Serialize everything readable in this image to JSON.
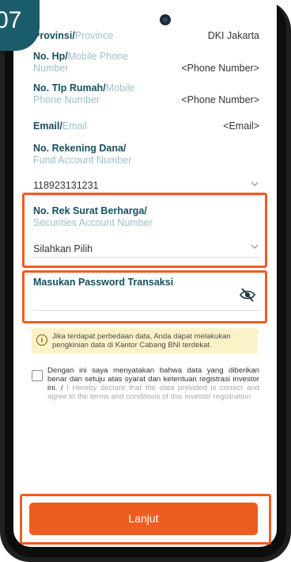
{
  "step_number": "07",
  "rows": [
    {
      "bold": "Provinsi/",
      "light": "Province",
      "value": "DKI Jakarta"
    },
    {
      "bold": "No. Hp/",
      "light": "Mobile Phone Number",
      "value": "<Phone Number>"
    },
    {
      "bold": "No. Tlp Rumah/",
      "light": "Mobile Phone Number",
      "value": "<Phone Number>"
    },
    {
      "bold": "Email/",
      "light": "Email",
      "value": "<Email>"
    }
  ],
  "fund_account": {
    "label_bold": "No. Rekening Dana/",
    "label_light": "Fund Account Number",
    "value": "118923131231"
  },
  "securities_account": {
    "label_bold": "No. Rek Surat Berharga/",
    "label_light": "Securities Account Number",
    "value": "Silahkan Pilih"
  },
  "password": {
    "label": "Masukan Password Transaksi",
    "value": ""
  },
  "info_note": "Jika terdapat perbedaan data, Anda dapat melakukan pengkinian data di Kantor Cabang BNI terdekat.",
  "consent": {
    "text_id": "Dengan ini saya menyatakan bahwa data yang diberikan benar dan setuju atas syarat dan ketentuan registrasi investor ini. /",
    "text_en": "I Hereby declare that the data provided is correct and agree to the terms and conditions of this investor registration"
  },
  "button_label": "Lanjut",
  "colors": {
    "label_dark": "#16505f",
    "label_light": "#9cc0c8",
    "highlight": "#ee5d20",
    "button": "#ee5d20",
    "info_bg": "#fcf2c8",
    "badge": "#1b5c6b"
  }
}
